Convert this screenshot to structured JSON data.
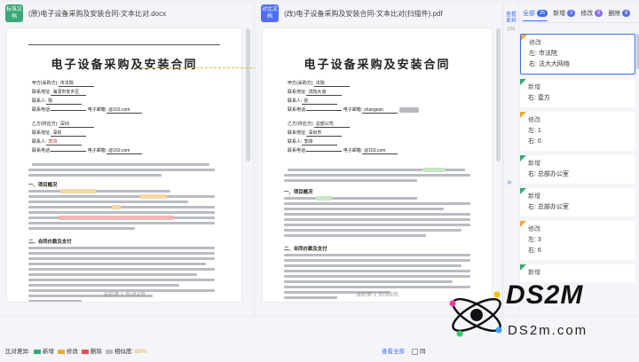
{
  "left_doc": {
    "badge": "标准文档",
    "title": "(原)电子设备采购及安装合同-文本比对.docx",
    "heading": "电子设备采购及安装合同",
    "fields": [
      {
        "label": "甲方(采购方):",
        "value": "市法院"
      },
      {
        "label": "联系地址:",
        "value": "海洞市安乡区"
      },
      {
        "label": "联系人:",
        "value": "陈"
      },
      {
        "label": "联系电话:",
        "value": "",
        "extra_label": "电子邮箱:",
        "extra_value": "@163.com"
      },
      {
        "label": "乙方(供应方):",
        "value": "深圳"
      },
      {
        "label": "联系地址:",
        "value": "深圳"
      },
      {
        "label": "联系人:",
        "value": "李四"
      },
      {
        "label": "联系电话:",
        "value": "",
        "extra_label": "电子邮箱:",
        "extra_value": "@163.com"
      }
    ],
    "sections": [
      "一、项目概况",
      "二、合同价款及支付"
    ],
    "footer": "当前第 1 页/共8页"
  },
  "right_doc": {
    "badge": "对比文档",
    "title": "(改)电子设备采购及安装合同-文本比对(扫描件).pdf",
    "heading": "电子设备采购及安装合同",
    "fields": [
      {
        "label": "甲方(采购方):",
        "value": "法院"
      },
      {
        "label": "联系地址:",
        "value": "法院大道"
      },
      {
        "label": "联系人:",
        "value": "张"
      },
      {
        "label": "联系电话:",
        "value": "",
        "extra_label": "电子邮箱:",
        "extra_value": "zhangsan"
      },
      {
        "label": "乙方(供应方):",
        "value": "总部公司"
      },
      {
        "label": "联系地址:",
        "value": "深圳市"
      },
      {
        "label": "联系人:",
        "value": "李四"
      },
      {
        "label": "联系电话:",
        "value": "",
        "extra_label": "电子邮箱:",
        "extra_value": "@163.com"
      }
    ],
    "sections": [
      "一、项目概况",
      "二、合同价款及支付"
    ],
    "footer": "当前第 1 页/共8页"
  },
  "sidenav": {
    "label": "查看差异",
    "count": "(25)"
  },
  "diff_panel": {
    "tabs": [
      {
        "label": "全部",
        "count": "25",
        "kind": "all"
      },
      {
        "label": "新增",
        "count": "9",
        "kind": "add"
      },
      {
        "label": "修改",
        "count": "8",
        "kind": "mod"
      },
      {
        "label": "删除",
        "count": "8",
        "kind": "del"
      }
    ],
    "cards": [
      {
        "type": "修改",
        "kind": "mod",
        "lines": [
          "左: 市法院",
          "右: 法大大网络"
        ],
        "active": true
      },
      {
        "type": "新增",
        "kind": "add",
        "lines": [
          "右: 壹方"
        ]
      },
      {
        "type": "修改",
        "kind": "mod",
        "lines": [
          "左: 1",
          "右: 0"
        ]
      },
      {
        "type": "新增",
        "kind": "add",
        "lines": [
          "右: 总部办公室"
        ]
      },
      {
        "type": "新增",
        "kind": "add",
        "lines": [
          "右: 总部办公室"
        ]
      },
      {
        "type": "修改",
        "kind": "mod",
        "lines": [
          "左: 3",
          "右: 6"
        ]
      },
      {
        "type": "新增",
        "kind": "add",
        "lines": []
      }
    ]
  },
  "bottom": {
    "legend_label": "比对差异:",
    "legend": [
      {
        "label": "新增",
        "color": "#3aa776"
      },
      {
        "label": "修改",
        "color": "#e9a93c"
      },
      {
        "label": "删除",
        "color": "#e05454"
      }
    ],
    "similarity_label": "相似度:",
    "similarity_value": "85%",
    "view_all": "查看全部",
    "sync_label": "同"
  },
  "watermark": {
    "brand": "DS2M",
    "site": "DS2m.com"
  },
  "colors": {
    "accent": "#3b6ef0",
    "added": "#3aa776",
    "modified": "#e9a93c",
    "deleted": "#e05454"
  }
}
